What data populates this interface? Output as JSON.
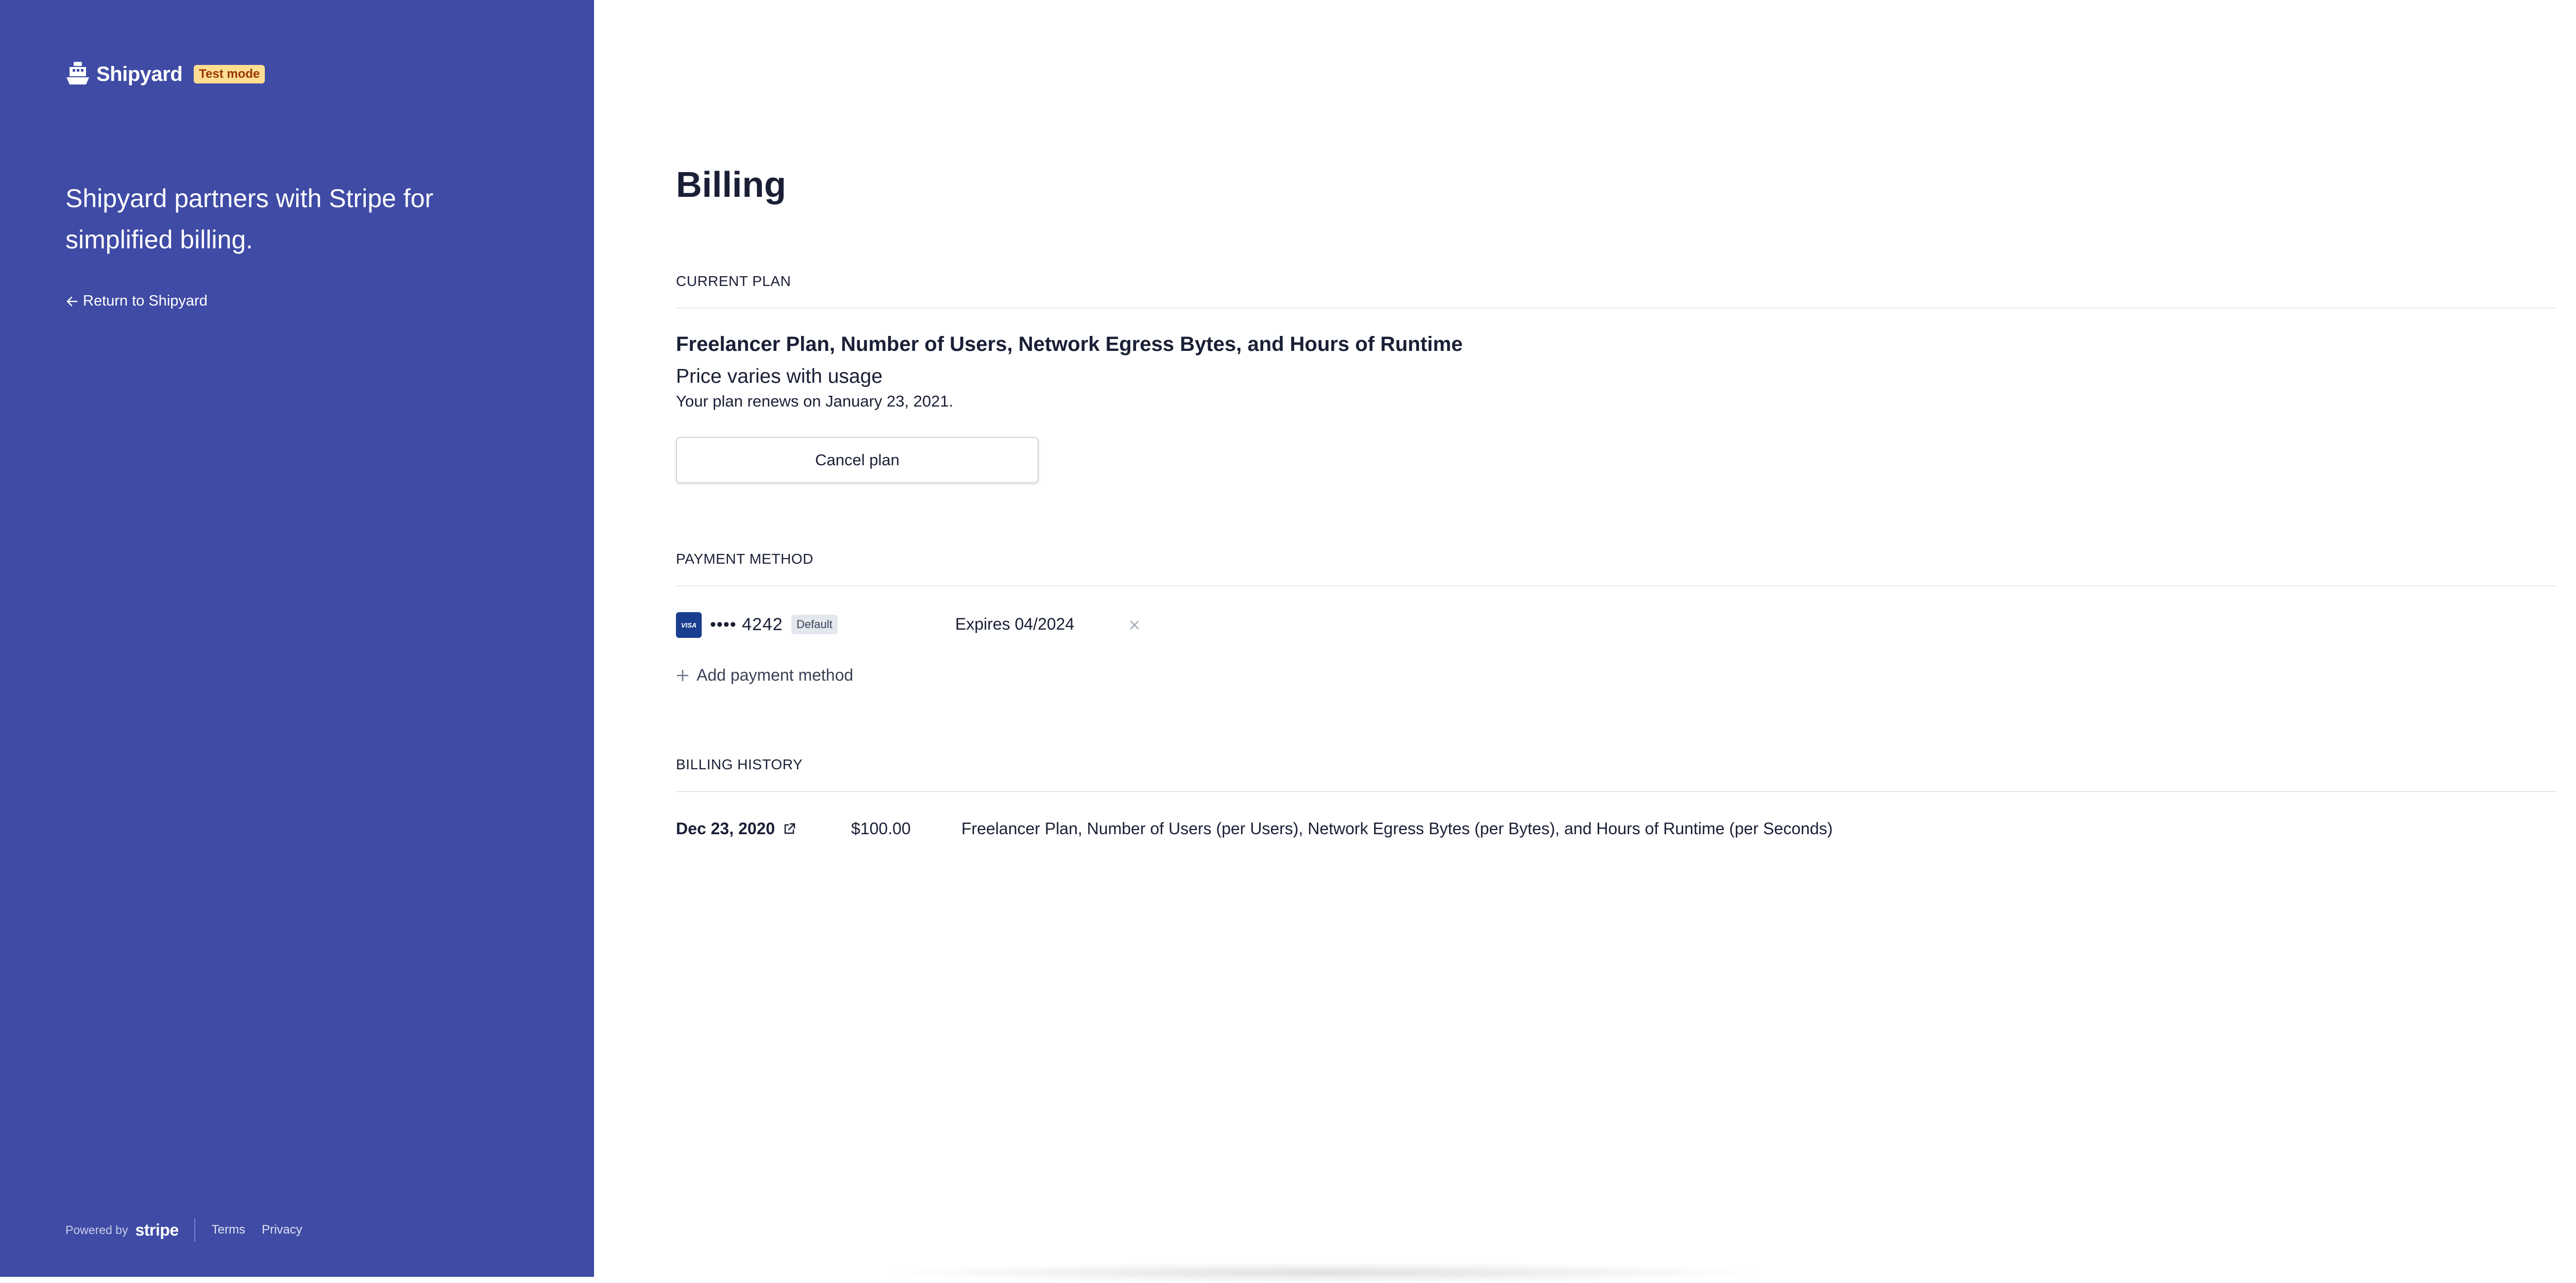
{
  "sidebar": {
    "brand_name": "Shipyard",
    "test_badge": "Test mode",
    "tagline": "Shipyard partners with Stripe for simplified billing.",
    "return_link": "Return to Shipyard",
    "footer": {
      "powered_by": "Powered by",
      "stripe_word": "stripe",
      "terms": "Terms",
      "privacy": "Privacy"
    },
    "background_color": "#3f4ba5"
  },
  "main": {
    "title": "Billing",
    "current_plan": {
      "heading": "CURRENT PLAN",
      "plan_name": "Freelancer Plan, Number of Users, Network Egress Bytes, and Hours of Runtime",
      "price": "Price varies with usage",
      "renewal": "Your plan renews on January 23, 2021.",
      "cancel_label": "Cancel plan"
    },
    "payment_method": {
      "heading": "PAYMENT METHOD",
      "card_brand": "VISA",
      "card_masked": "•••• 4242",
      "default_badge": "Default",
      "expires": "Expires 04/2024",
      "add_label": "Add payment method"
    },
    "billing_history": {
      "heading": "BILLING HISTORY",
      "rows": [
        {
          "date": "Dec 23, 2020",
          "amount": "$100.00",
          "description": "Freelancer Plan, Number of Users (per Users), Network Egress Bytes (per Bytes), and Hours of Runtime (per Seconds)"
        }
      ]
    }
  },
  "icons": [
    "shipyard-logo-icon",
    "arrow-left-icon",
    "visa-card-icon",
    "close-icon",
    "plus-icon",
    "external-link-icon"
  ],
  "colors": {
    "test_badge_bg": "#ffde92",
    "test_badge_text": "#983705",
    "visa_blue": "#1a3e8f"
  }
}
